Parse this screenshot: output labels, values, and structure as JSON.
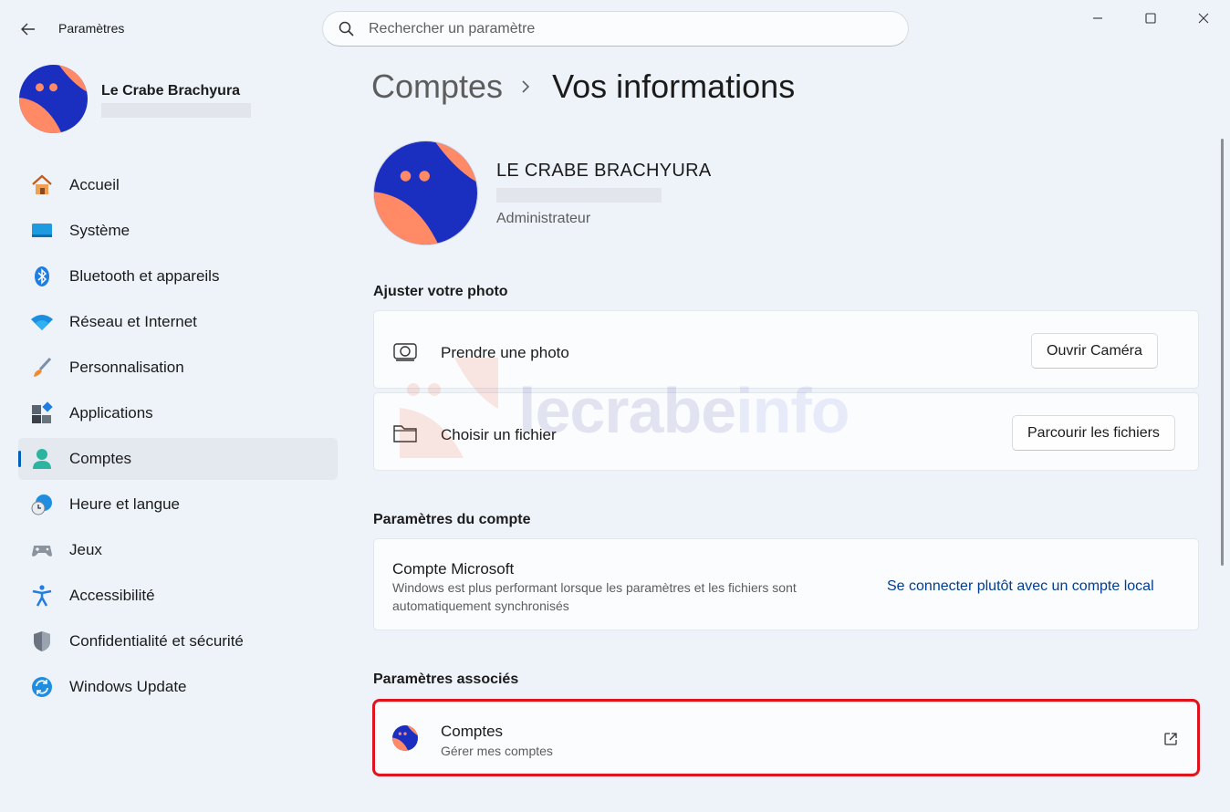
{
  "window": {
    "title": "Paramètres",
    "search_placeholder": "Rechercher un paramètre"
  },
  "profile": {
    "name": "Le Crabe Brachyura"
  },
  "sidebar": {
    "items": [
      {
        "label": "Accueil",
        "icon": "home-icon"
      },
      {
        "label": "Système",
        "icon": "monitor-icon"
      },
      {
        "label": "Bluetooth et appareils",
        "icon": "bluetooth-icon"
      },
      {
        "label": "Réseau et Internet",
        "icon": "wifi-icon"
      },
      {
        "label": "Personnalisation",
        "icon": "brush-icon"
      },
      {
        "label": "Applications",
        "icon": "apps-icon"
      },
      {
        "label": "Comptes",
        "icon": "person-icon",
        "active": true
      },
      {
        "label": "Heure et langue",
        "icon": "clock-globe-icon"
      },
      {
        "label": "Jeux",
        "icon": "gamepad-icon"
      },
      {
        "label": "Accessibilité",
        "icon": "accessibility-icon"
      },
      {
        "label": "Confidentialité et sécurité",
        "icon": "shield-icon"
      },
      {
        "label": "Windows Update",
        "icon": "update-icon"
      }
    ]
  },
  "breadcrumb": {
    "parent": "Comptes",
    "current": "Vos informations"
  },
  "user": {
    "display_name": "LE CRABE BRACHYURA",
    "role": "Administrateur"
  },
  "photo_section": {
    "title": "Ajuster votre photo",
    "take_photo_label": "Prendre une photo",
    "open_camera_button": "Ouvrir Caméra",
    "choose_file_label": "Choisir un fichier",
    "browse_files_button": "Parcourir les fichiers"
  },
  "account_section": {
    "title": "Paramètres du compte",
    "microsoft_account_label": "Compte Microsoft",
    "microsoft_account_desc": "Windows est plus performant lorsque les paramètres et les fichiers sont automatiquement synchronisés",
    "local_account_link": "Se connecter plutôt avec un compte local"
  },
  "related_section": {
    "title": "Paramètres associés",
    "accounts_label": "Comptes",
    "accounts_desc": "Gérer mes comptes"
  },
  "watermark": {
    "part1": "lecrabe",
    "part2": "info"
  },
  "colors": {
    "accent": "#005fb8",
    "avatar_blue": "#1a2fc0",
    "avatar_orange": "#ff8a65",
    "highlight": "#e0141c",
    "link": "#003e92"
  }
}
